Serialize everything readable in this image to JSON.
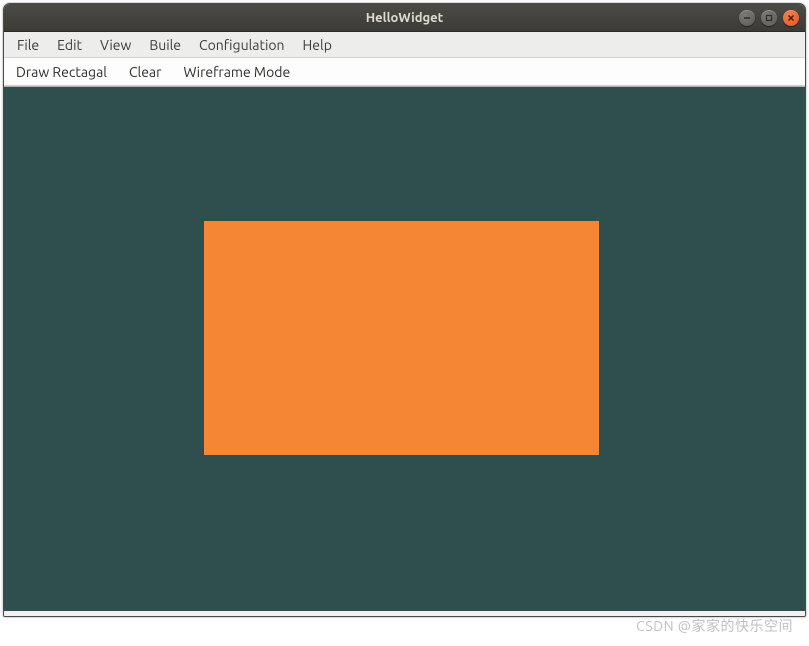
{
  "window": {
    "title": "HelloWidget"
  },
  "menubar": {
    "items": [
      "File",
      "Edit",
      "View",
      "Buile",
      "Configulation",
      "Help"
    ]
  },
  "toolbar": {
    "items": [
      "Draw Rectagal",
      "Clear",
      "Wireframe Mode"
    ]
  },
  "viewport": {
    "background_color": "#2f4f4f",
    "rectangle": {
      "fill_color": "#f58634"
    }
  },
  "watermark": "CSDN @家家的快乐空间"
}
